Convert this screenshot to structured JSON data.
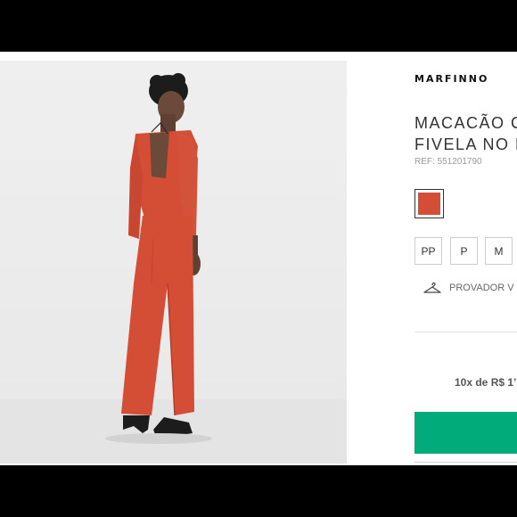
{
  "brand": "MARFINNO",
  "product": {
    "title_line1": "MACACÃO C",
    "title_line2": "FIVELA NO D",
    "ref": "REF: 551201790"
  },
  "color_swatch": {
    "color": "#d44d35"
  },
  "sizes": [
    "PP",
    "P",
    "M"
  ],
  "provador": {
    "label": "PROVADOR V",
    "icon": "hanger-icon"
  },
  "price": {
    "installments": "10x de R$ 1’"
  },
  "buy_button": {
    "color": "#02ac7a"
  },
  "colors": {
    "garment": "#d44d35",
    "background": "#ececec"
  }
}
